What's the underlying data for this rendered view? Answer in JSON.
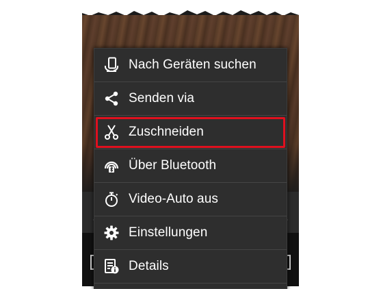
{
  "menu": {
    "items": [
      {
        "label": "Nach Geräten suchen",
        "icon": "device-search-icon"
      },
      {
        "label": "Senden via",
        "icon": "share-icon"
      },
      {
        "label": "Zuschneiden",
        "icon": "scissors-icon",
        "highlighted": true
      },
      {
        "label": "Über Bluetooth",
        "icon": "bluetooth-icon"
      },
      {
        "label": "Video-Auto aus",
        "icon": "stopwatch-icon"
      },
      {
        "label": "Einstellungen",
        "icon": "gear-icon"
      },
      {
        "label": "Details",
        "icon": "details-icon"
      }
    ]
  },
  "colors": {
    "menu_background": "#2e2e2e",
    "menu_text": "#ffffff",
    "highlight_border": "#e0101e",
    "progress_accent": "#33b5e5"
  }
}
